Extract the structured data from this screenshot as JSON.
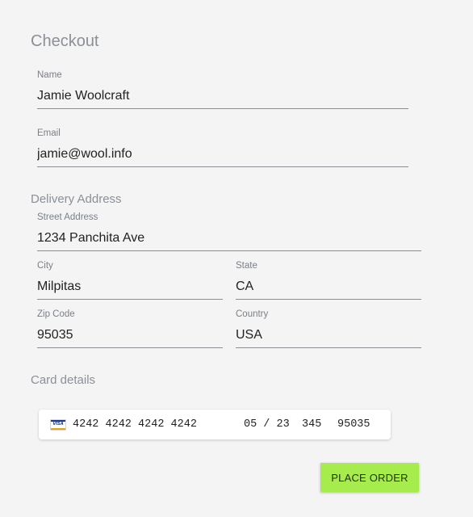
{
  "checkout": {
    "title": "Checkout"
  },
  "fields": {
    "name": {
      "label": "Name",
      "value": "Jamie Woolcraft"
    },
    "email": {
      "label": "Email",
      "value": "jamie@wool.info"
    }
  },
  "delivery": {
    "title": "Delivery Address",
    "street": {
      "label": "Street Address",
      "value": "1234 Panchita Ave"
    },
    "city": {
      "label": "City",
      "value": "Milpitas"
    },
    "state": {
      "label": "State",
      "value": "CA"
    },
    "zip": {
      "label": "Zip Code",
      "value": "95035"
    },
    "country": {
      "label": "Country",
      "value": "USA"
    }
  },
  "card": {
    "title": "Card details",
    "brand_icon": "visa-card-icon",
    "brand_text": "VISA",
    "number": "4242 4242 4242 4242",
    "expiry": "05 / 23",
    "cvc": "345",
    "postal": "95035"
  },
  "actions": {
    "place_order": "PLACE ORDER"
  },
  "colors": {
    "background": "#f4f4f4",
    "accent_button": "#a6ec4d",
    "muted_text": "#8b9097",
    "underline": "#8b8f94"
  }
}
